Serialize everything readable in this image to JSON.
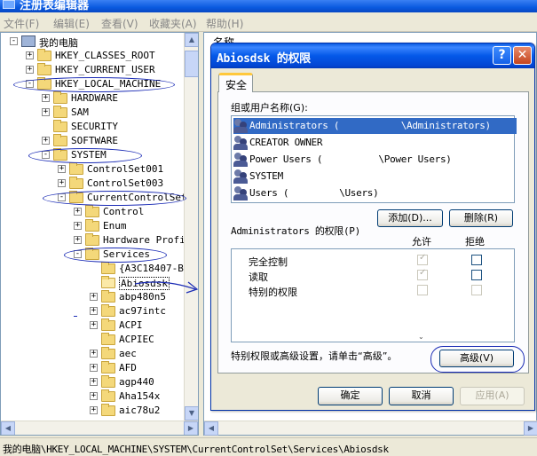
{
  "main_window": {
    "title": "注册表编辑器",
    "menu": [
      {
        "label": "文件(F)",
        "key": "file"
      },
      {
        "label": "编辑(E)",
        "key": "edit"
      },
      {
        "label": "查看(V)",
        "key": "view"
      },
      {
        "label": "收藏夹(A)",
        "key": "favorites"
      },
      {
        "label": "帮助(H)",
        "key": "help"
      }
    ],
    "list_header": "名称",
    "status_text": "我的电脑\\HKEY_LOCAL_MACHINE\\SYSTEM\\CurrentControlSet\\Services\\Abiosdsk"
  },
  "tree": [
    {
      "label": "我的电脑",
      "expander": "-",
      "icon": "computer"
    },
    {
      "label": "HKEY_CLASSES_ROOT",
      "expander": "+",
      "icon": "folder"
    },
    {
      "label": "HKEY_CURRENT_USER",
      "expander": "+",
      "icon": "folder"
    },
    {
      "label": "HKEY_LOCAL_MACHINE",
      "expander": "-",
      "icon": "folder"
    },
    {
      "label": "HARDWARE",
      "expander": "+",
      "icon": "folder"
    },
    {
      "label": "SAM",
      "expander": "+",
      "icon": "folder"
    },
    {
      "label": "SECURITY",
      "expander": "",
      "icon": "folder"
    },
    {
      "label": "SOFTWARE",
      "expander": "+",
      "icon": "folder"
    },
    {
      "label": "SYSTEM",
      "expander": "-",
      "icon": "folder"
    },
    {
      "label": "ControlSet001",
      "expander": "+",
      "icon": "folder"
    },
    {
      "label": "ControlSet003",
      "expander": "+",
      "icon": "folder"
    },
    {
      "label": "CurrentControlSet",
      "expander": "-",
      "icon": "folder"
    },
    {
      "label": "Control",
      "expander": "+",
      "icon": "folder"
    },
    {
      "label": "Enum",
      "expander": "+",
      "icon": "folder"
    },
    {
      "label": "Hardware Profil",
      "expander": "+",
      "icon": "folder"
    },
    {
      "label": "Services",
      "expander": "-",
      "icon": "folder"
    },
    {
      "label": "{A3C18407-B",
      "expander": "",
      "icon": "folder"
    },
    {
      "label": "Abiosdsk",
      "expander": "",
      "icon": "folder-open",
      "selected": true
    },
    {
      "label": "abp480n5",
      "expander": "+",
      "icon": "folder"
    },
    {
      "label": "ac97intc",
      "expander": "+",
      "icon": "folder"
    },
    {
      "label": "ACPI",
      "expander": "+",
      "icon": "folder"
    },
    {
      "label": "ACPIEC",
      "expander": "",
      "icon": "folder"
    },
    {
      "label": "aec",
      "expander": "+",
      "icon": "folder"
    },
    {
      "label": "AFD",
      "expander": "+",
      "icon": "folder"
    },
    {
      "label": "agp440",
      "expander": "+",
      "icon": "folder"
    },
    {
      "label": "Aha154x",
      "expander": "+",
      "icon": "folder"
    },
    {
      "label": "aic78u2",
      "expander": "+",
      "icon": "folder"
    }
  ],
  "dialog": {
    "title": "Abiosdsk 的权限",
    "help_glyph": "?",
    "close_glyph": "✕",
    "tab_label": "安全",
    "group_label": "组或用户名称(G):",
    "users": [
      {
        "name": "Administrators (           \\Administrators)",
        "selected": true
      },
      {
        "name": "CREATOR OWNER",
        "selected": false
      },
      {
        "name": "Power Users (          \\Power Users)",
        "selected": false
      },
      {
        "name": "SYSTEM",
        "selected": false
      },
      {
        "name": "Users (         \\Users)",
        "selected": false
      }
    ],
    "add_button": "添加(D)...",
    "remove_button": "删除(R)",
    "perm_title": "Administrators 的权限(P)",
    "col_allow": "允许",
    "col_deny": "拒绝",
    "permissions": [
      {
        "name": "完全控制",
        "allow": true,
        "deny": false
      },
      {
        "name": "读取",
        "allow": true,
        "deny": false
      },
      {
        "name": "特别的权限",
        "allow": false,
        "deny": false
      }
    ],
    "advanced_text": "特别权限或高级设置，请单击“高级”。",
    "advanced_button": "高级(V)",
    "ok_button": "确定",
    "cancel_button": "取消",
    "apply_button": "应用(A)"
  },
  "colors": {
    "selection": "#316ac5",
    "annotation": "#1a2bb5",
    "titlebar": "#0458e8"
  }
}
